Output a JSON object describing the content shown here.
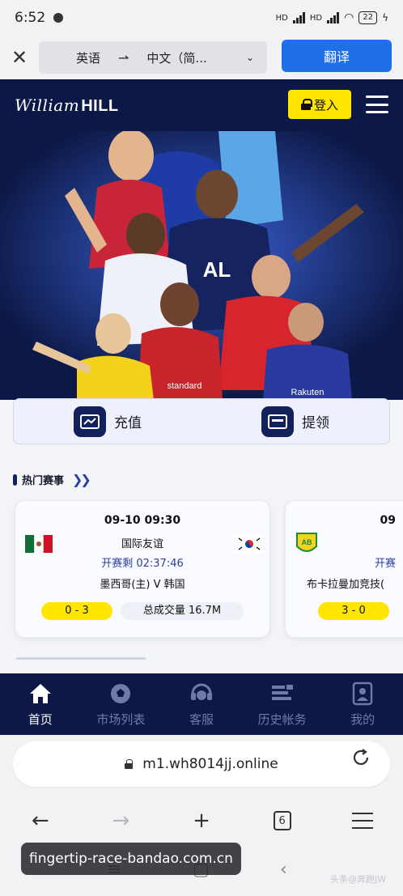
{
  "status_bar": {
    "time": "6:52",
    "battery": "22",
    "network_1": "HD",
    "network_2": "HD"
  },
  "translate_bar": {
    "source_lang": "英语",
    "target_lang": "中文（简...",
    "button": "翻译"
  },
  "site_header": {
    "logo_script": "William",
    "logo_bold": "HILL",
    "login_label": "登入"
  },
  "actions": {
    "deposit": "充值",
    "withdraw": "提领"
  },
  "hot_section": {
    "title": "热门赛事"
  },
  "matches": [
    {
      "time": "09-10 09:30",
      "league": "国际友谊",
      "countdown": "开赛剩 02:37:46",
      "teams": "墨西哥(主)  V  韩国",
      "score": "0 - 3",
      "volume": "总成交量 16.7M"
    },
    {
      "time": "09",
      "league": "",
      "countdown": "开赛",
      "teams": "布卡拉曼加竞技(",
      "score": "3 - 0",
      "volume": ""
    }
  ],
  "tabbar": [
    {
      "label": "首页",
      "icon": "home-icon",
      "active": true
    },
    {
      "label": "市场列表",
      "icon": "soccer-ball-icon"
    },
    {
      "label": "客服",
      "icon": "chat-headset-icon"
    },
    {
      "label": "历史帐务",
      "icon": "history-icon"
    },
    {
      "label": "我的",
      "icon": "profile-icon"
    }
  ],
  "browser": {
    "url": "m1.wh8014jj.online",
    "tab_count": "6"
  },
  "watermark": {
    "text": "fingertip-race-bandao.com.cn",
    "corner": "头条@奔跑JW"
  },
  "colors": {
    "navy": "#0c1845",
    "yellow": "#ffe500",
    "blue": "#1f6fe8"
  }
}
